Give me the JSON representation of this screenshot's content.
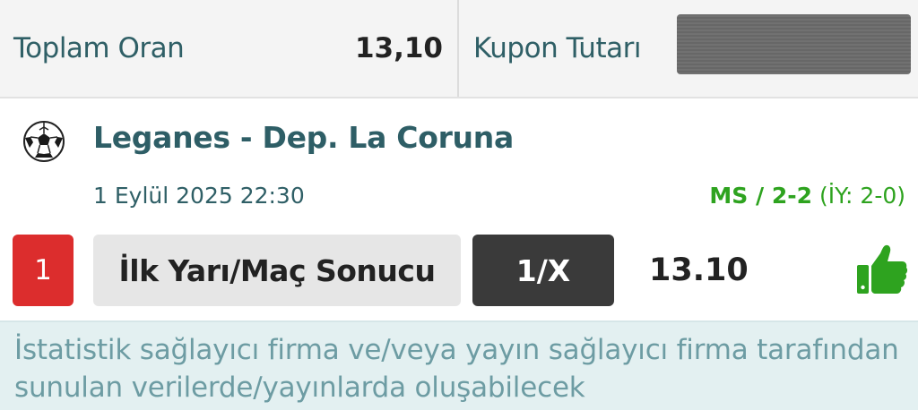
{
  "coupon_summary": {
    "total_odds_label": "Toplam Oran",
    "total_odds_value": "13,10",
    "stake_label": "Kupon Tutarı",
    "stake_value": ""
  },
  "event": {
    "sport_icon": "soccer-ball-icon",
    "title": "Leganes - Dep. La Coruna",
    "datetime": "1 Eylül 2025 22:30",
    "score_ms": "MS / 2-2",
    "score_ht": " (İY: 2-0)",
    "selection": {
      "number": "1",
      "market": "İlk Yarı/Maç Sonucu",
      "pick": "1/X",
      "odds": "13.10",
      "status_icon": "thumbs-up-icon"
    }
  },
  "disclaimer": "İstatistik sağlayıcı firma ve/veya yayın sağlayıcı firma tarafından sunulan verilerde/yayınlarda oluşabilecek",
  "colors": {
    "primary_text": "#2e5e66",
    "win_green": "#2ea31f",
    "selection_red": "#dc2d2d",
    "pick_dark": "#3a3a3a",
    "disclaimer_bg": "#e3f0f1"
  }
}
